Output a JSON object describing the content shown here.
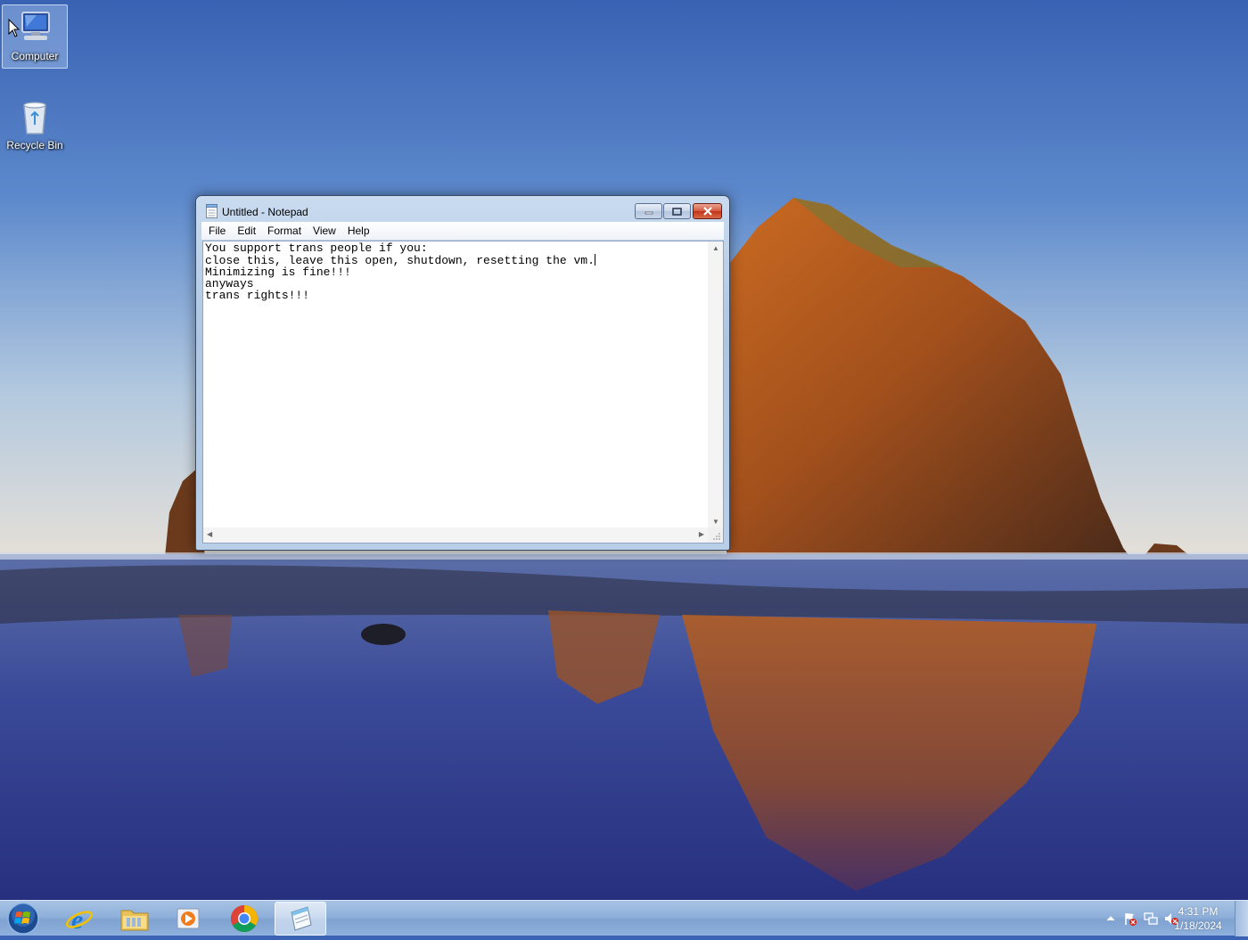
{
  "desktop": {
    "icons": [
      {
        "label": "Computer",
        "icon": "computer-icon",
        "selected": true
      },
      {
        "label": "Recycle Bin",
        "icon": "recycle-bin-icon",
        "selected": false
      }
    ]
  },
  "notepad": {
    "title": "Untitled - Notepad",
    "menu": [
      "File",
      "Edit",
      "Format",
      "View",
      "Help"
    ],
    "text_lines": [
      "You support trans people if you:",
      "close this, leave this open, shutdown, resetting the vm.",
      "Minimizing is fine!!!",
      "anyways",
      "trans rights!!!"
    ],
    "caret_after_line": 1
  },
  "taskbar": {
    "start_icon": "windows-start-icon",
    "apps": [
      {
        "name": "internet-explorer-icon",
        "active": false
      },
      {
        "name": "file-explorer-icon",
        "active": false
      },
      {
        "name": "media-player-icon",
        "active": false
      },
      {
        "name": "chrome-icon",
        "active": false
      },
      {
        "name": "notepad-icon",
        "active": true
      }
    ],
    "tray_icons": [
      "show-hidden-icons-chevron-icon",
      "action-center-flag-icon",
      "network-icon",
      "volume-muted-icon"
    ],
    "clock": {
      "time": "4:31 PM",
      "date": "1/18/2024"
    }
  },
  "colors": {
    "taskbar": "#8fb0da",
    "close_button": "#c23418",
    "window_frame": "#aec6e2",
    "sky_top": "#3b63b4",
    "rock": "#a8561e"
  }
}
